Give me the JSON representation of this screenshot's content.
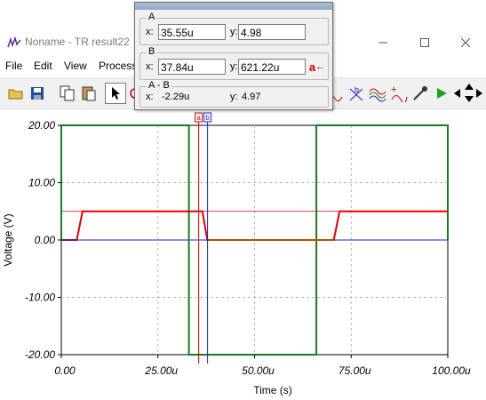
{
  "window": {
    "title": "Noname - TR result22"
  },
  "menu": [
    "File",
    "Edit",
    "View",
    "Process"
  ],
  "cursor_panel": {
    "a": {
      "header": "A",
      "x_label": "x:",
      "x_value": "35.55u",
      "y_label": "y:",
      "y_value": "4.98"
    },
    "b": {
      "header": "B",
      "x_label": "x:",
      "x_value": "37.84u",
      "y_label": "y:",
      "y_value": "621.22u"
    },
    "diff": {
      "header": "A - B",
      "x_label": "x:",
      "x_value": "-2.29u",
      "y_label": "y:",
      "y_value": "4.97"
    },
    "marker_button": "a"
  },
  "chart_data": {
    "type": "line",
    "xlabel": "Time (s)",
    "ylabel": "Voltage (V)",
    "xlim": [
      0,
      100
    ],
    "ylim": [
      -20,
      20
    ],
    "x_unit": "u",
    "xticks": [
      0,
      25,
      50,
      75,
      100
    ],
    "yticks": [
      20,
      10,
      0,
      -10,
      -20
    ],
    "xtick_labels": [
      "0.00",
      "25.00u",
      "50.00u",
      "75.00u",
      "100.00u"
    ],
    "ytick_labels": [
      "20.00",
      "10.00",
      "0.00",
      "-10.00",
      "-20.00"
    ],
    "grid": true,
    "series": [
      {
        "color": "#1f7a1f",
        "x": [
          0,
          0,
          33,
          33,
          66,
          66,
          100,
          100
        ],
        "y": [
          0,
          20,
          20,
          -20,
          -20,
          20,
          20,
          0
        ]
      },
      {
        "color": "#e00000",
        "x": [
          0,
          4,
          5.5,
          36.5,
          37.8,
          70.5,
          72,
          100
        ],
        "y": [
          0,
          0,
          5,
          5,
          0,
          0,
          5,
          5
        ]
      },
      {
        "color": "#2020c0",
        "x": [
          0,
          100
        ],
        "y": [
          0,
          0
        ]
      },
      {
        "color": "#9aa000",
        "x": [
          37.8,
          70.5
        ],
        "y": [
          0,
          0
        ]
      }
    ],
    "cursors": [
      {
        "label": "a",
        "x": 35.55,
        "color": "#c00000"
      },
      {
        "label": "b",
        "x": 37.84,
        "color": "#2020c0"
      }
    ],
    "cursor_a_level": 5
  }
}
